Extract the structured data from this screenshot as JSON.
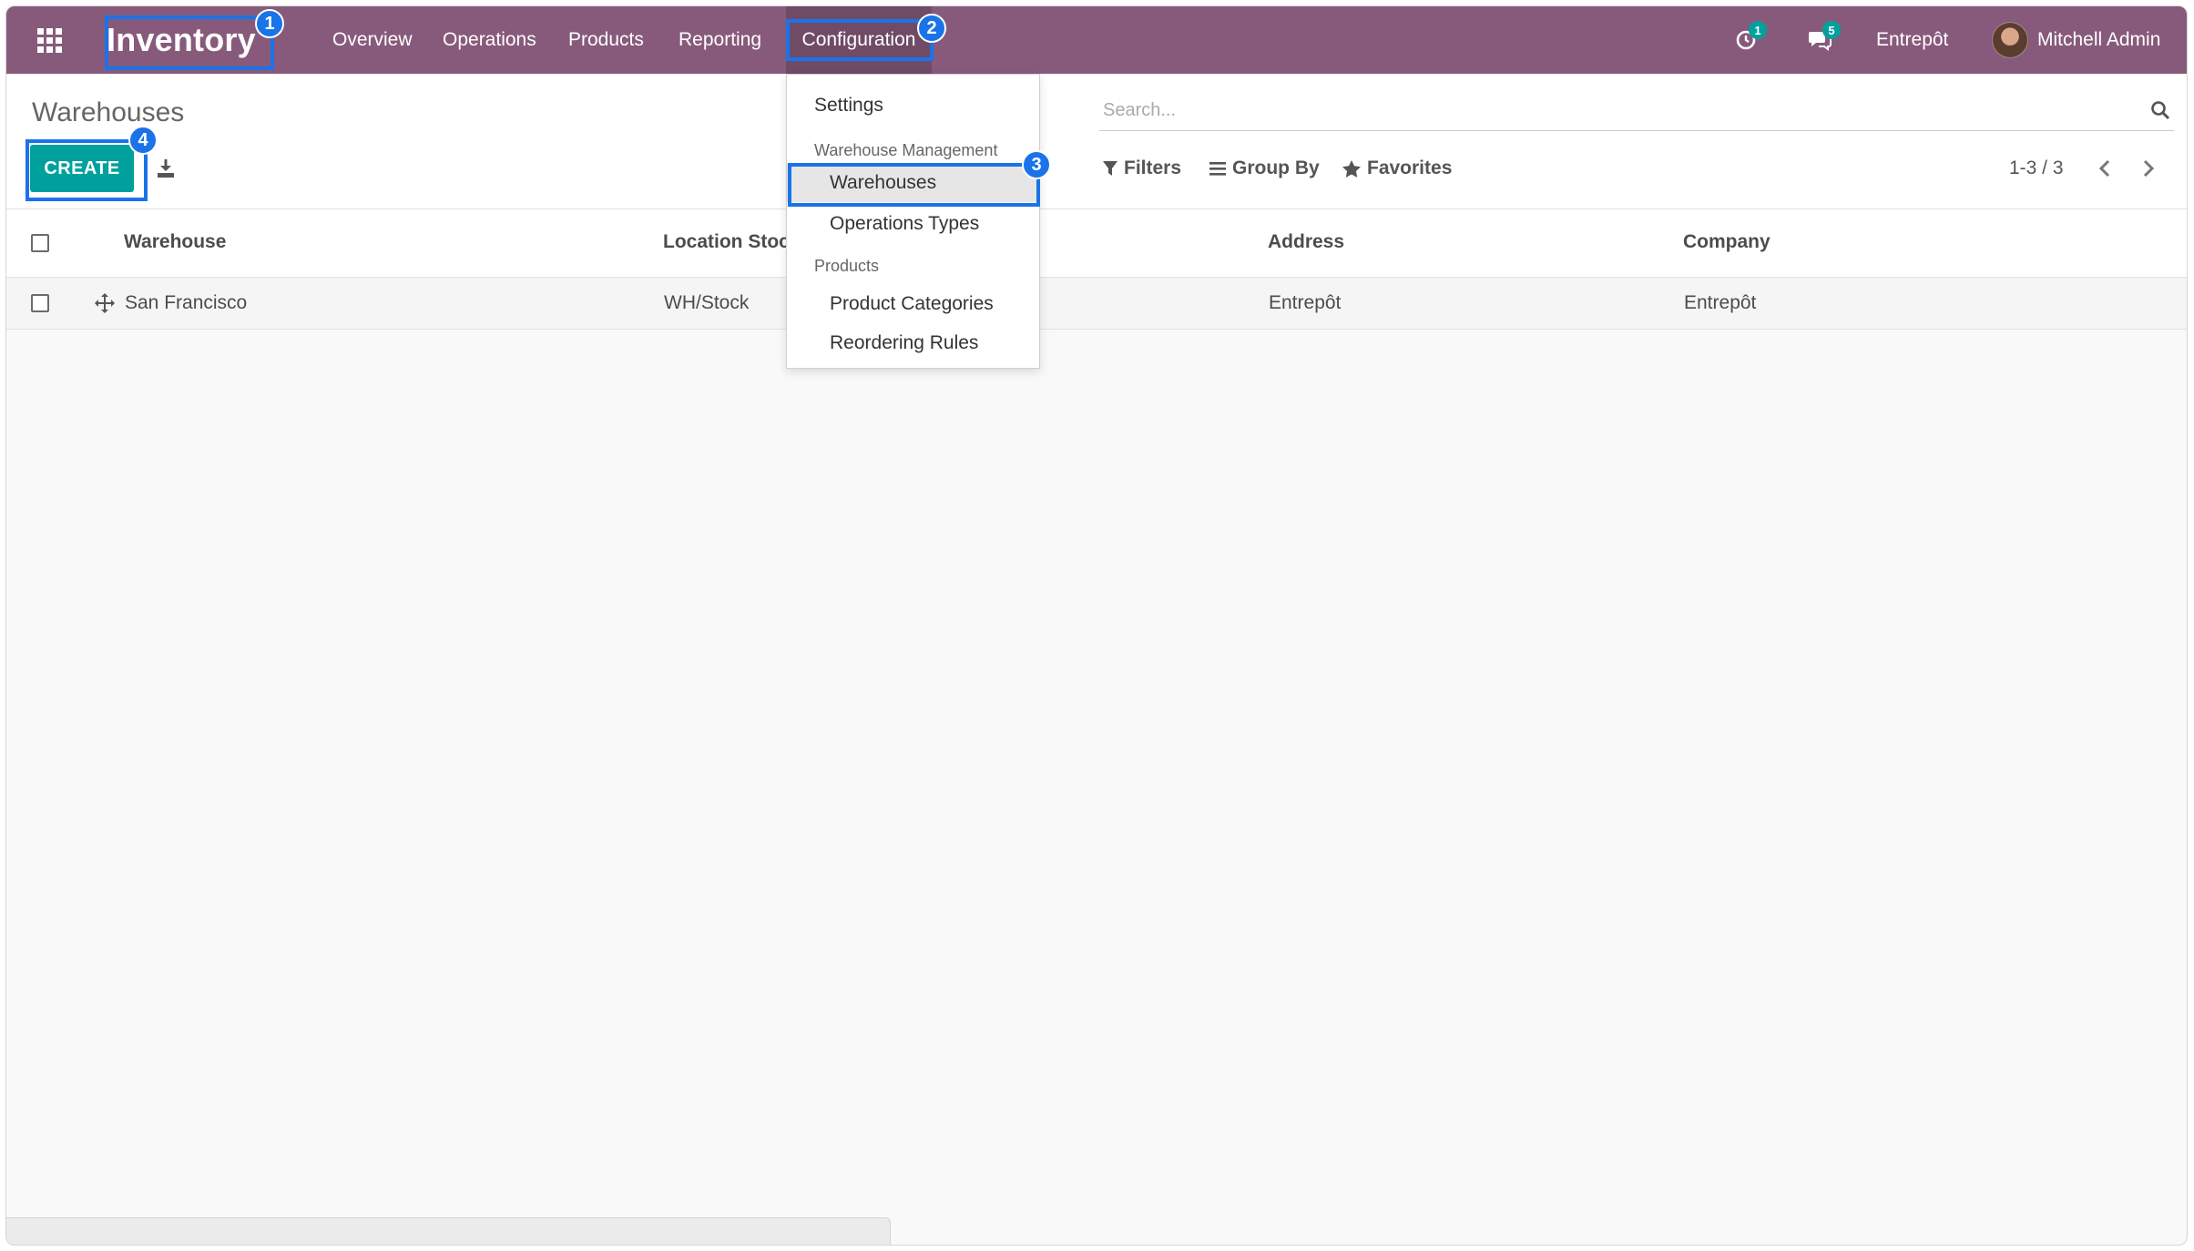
{
  "navbar": {
    "brand": "Inventory",
    "menu": [
      "Overview",
      "Operations",
      "Products",
      "Reporting",
      "Configuration"
    ],
    "activity_count": "1",
    "messages_count": "5",
    "company": "Entrepôt",
    "user": "Mitchell Admin",
    "color": "#875a7b"
  },
  "control_panel": {
    "title": "Warehouses",
    "create_label": "CREATE",
    "search_placeholder": "Search...",
    "filters_label": "Filters",
    "groupby_label": "Group By",
    "favorites_label": "Favorites",
    "pager": "1-3 / 3"
  },
  "list": {
    "columns": [
      "Warehouse",
      "Location Stoc",
      "Address",
      "Company"
    ],
    "rows": [
      {
        "warehouse": "San Francisco",
        "location": "WH/Stock",
        "address": "Entrepôt",
        "company": "Entrepôt"
      }
    ]
  },
  "configuration_menu": {
    "settings": "Settings",
    "warehouse_management_header": "Warehouse Management",
    "warehouses": "Warehouses",
    "operations_types": "Operations Types",
    "products_header": "Products",
    "product_categories": "Product Categories",
    "reordering_rules": "Reordering Rules"
  },
  "callouts": [
    "1",
    "2",
    "3",
    "4"
  ],
  "colors": {
    "accent": "#00a09d",
    "callout": "#1a73e8"
  },
  "icons": [
    "apps-grid-icon",
    "activity-clock-icon",
    "chat-icon",
    "download-icon",
    "search-icon",
    "filter-icon",
    "list-icon",
    "star-icon",
    "drag-handle-icon",
    "chevron-left-icon",
    "chevron-right-icon"
  ]
}
